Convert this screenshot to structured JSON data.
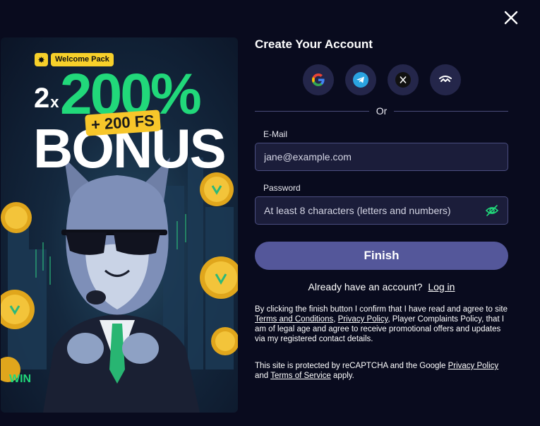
{
  "promo": {
    "badge": "Welcome Pack",
    "multiplier": "2",
    "multiplier_x": "x",
    "percent": "200%",
    "free_spins": "+ 200 FS",
    "bonus": "BONUS",
    "coin_text": "WIN"
  },
  "form": {
    "title": "Create Your Account",
    "socials": [
      "google-icon",
      "telegram-icon",
      "x-icon",
      "walletconnect-icon"
    ],
    "or": "Or",
    "email_label": "E-Mail",
    "email_placeholder": "jane@example.com",
    "password_label": "Password",
    "password_placeholder": "At least 8 characters (letters and numbers)",
    "finish": "Finish",
    "have_account": "Already have an account?",
    "login": "Log in"
  },
  "legal": {
    "p1_a": "By clicking the finish button I confirm that I have read and agree to site ",
    "terms": "Terms and Conditions",
    "comma": ", ",
    "privacy": "Privacy Policy",
    "p1_b": ", Player Complaints Policy, that I am of legal age and agree to receive promotional offers and updates via my registered contact details.",
    "p2_a": "This site is protected by reCAPTCHA and the Google ",
    "google_privacy": "Privacy Policy",
    "p2_b": " and ",
    "tos": "Terms of Service",
    "p2_c": " apply."
  },
  "colors": {
    "background": "#090b1e",
    "green": "#21d87a",
    "yellow": "#f7c62a",
    "button": "#54579a"
  }
}
